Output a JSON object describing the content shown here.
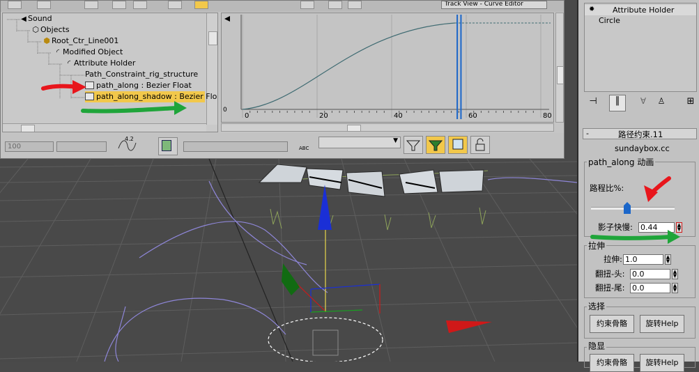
{
  "tree": {
    "items": [
      {
        "label": "Sound",
        "icon": "speaker-icon"
      },
      {
        "label": "Objects",
        "icon": "cube-icon"
      },
      {
        "label": "Root_Ctr_Line001",
        "icon": "object-icon"
      },
      {
        "label": "Modified Object",
        "icon": "modifier-icon"
      },
      {
        "label": "Attribute Holder",
        "icon": "modifier-icon"
      },
      {
        "label": "Path_Constraint_rig_structure",
        "icon": ""
      },
      {
        "label": "path_along : Bezier Float",
        "icon": "curve-icon"
      },
      {
        "label": "path_along_shadow : Bezier Flo",
        "icon": "curve-icon"
      }
    ]
  },
  "graph": {
    "x_ticks": [
      "0",
      "20",
      "40",
      "60",
      "80"
    ],
    "y_zero": "0"
  },
  "toolbar": {
    "view_dropdown": "Track View - Curve Editor",
    "frame_field": "100",
    "tangent_value": "4.2",
    "abc_label": "ABC"
  },
  "panel": {
    "modifier_stack": [
      "Attribute Holder",
      "Circle"
    ],
    "rollout_title": "路径约束.11",
    "author": "sundaybox.cc",
    "anim_group": "path_along 动画",
    "path_ratio_label": "路程比%:",
    "slider_value": 0.43,
    "shadow_label": "影子快慢:",
    "shadow_value": "0.44",
    "stretch_group": "拉伸",
    "stretch_label": "拉伸:",
    "stretch_value": "1.0",
    "twist_head_label": "翻扭-头:",
    "twist_head_value": "0.0",
    "twist_tail_label": "翻扭-尾:",
    "twist_tail_value": "0.0",
    "select_group": "选择",
    "btn_constraint_bones": "约束骨骼",
    "btn_rotate_help": "旋转Help",
    "display_group": "隐显",
    "btn_bottom_1": "约束骨骼",
    "btn_bottom_2": "旋转Help"
  },
  "colors": {
    "tree_selection": "#f2c84b",
    "curve": "#3f6b72",
    "time_slider": "#1b66c9",
    "annotation_red": "#e8161c",
    "annotation_green": "#1fa53a",
    "axis_blue": "#1a2fd6",
    "axis_green": "#18a020",
    "axis_red": "#d01818"
  }
}
